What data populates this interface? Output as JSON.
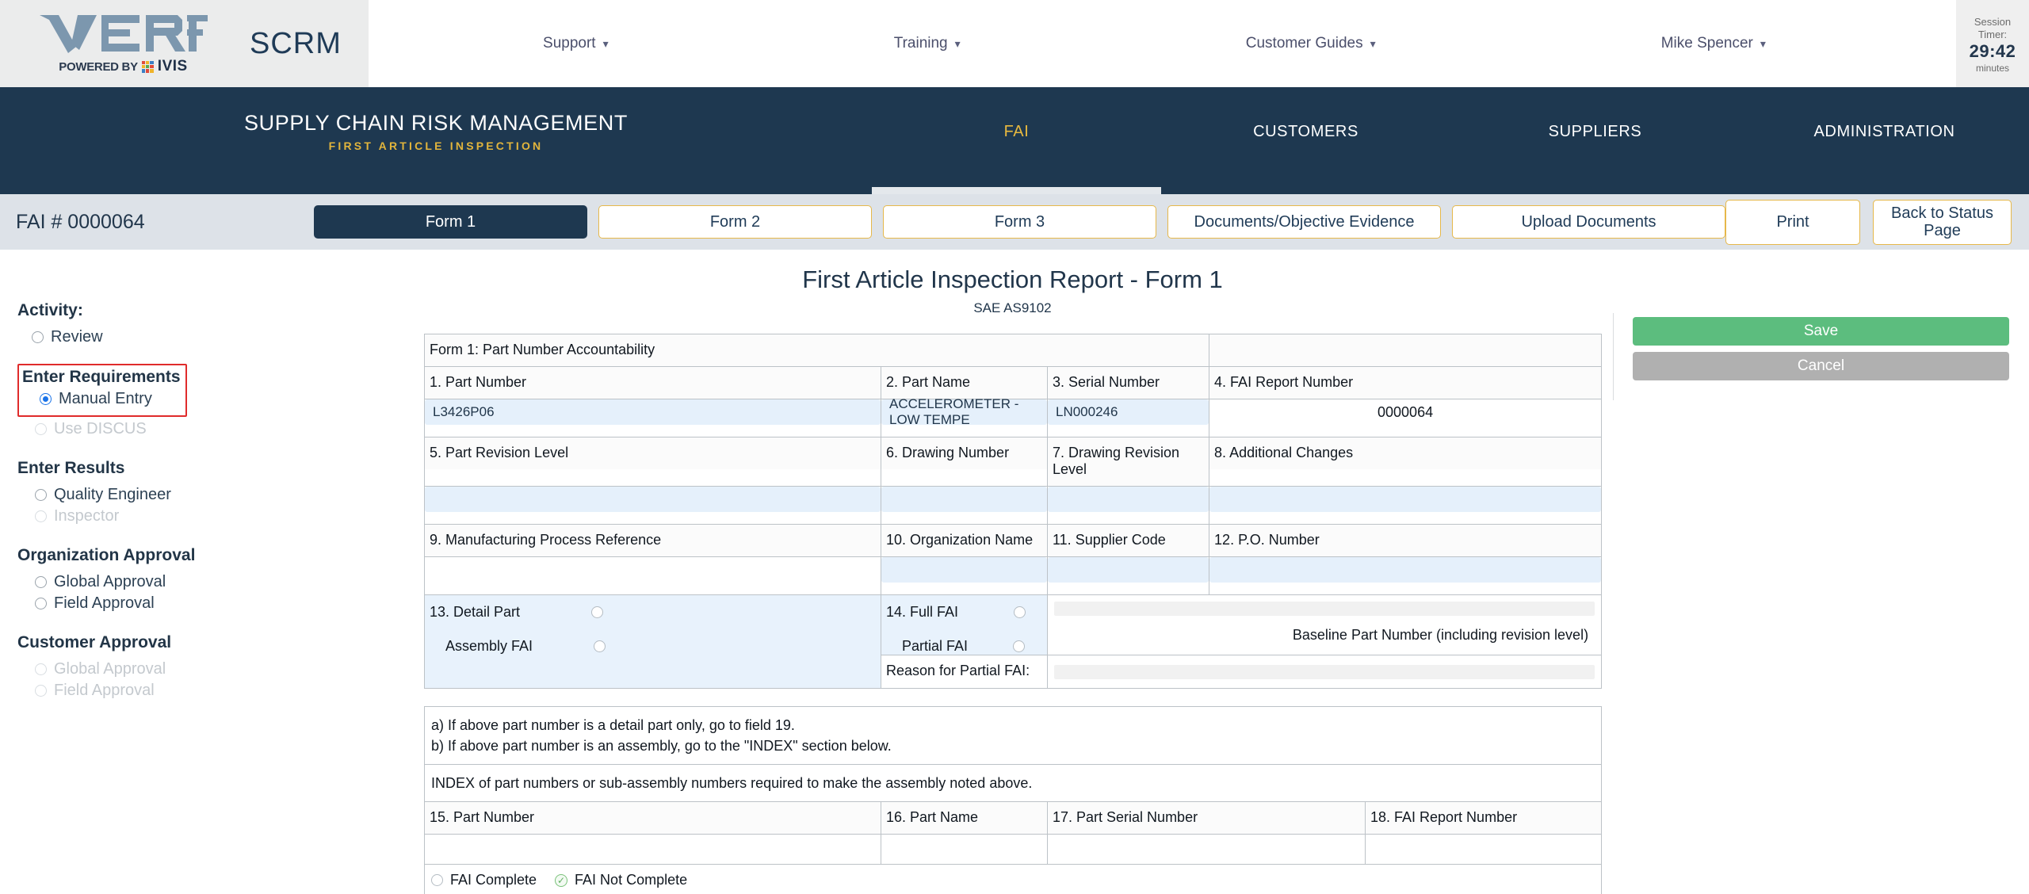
{
  "brand": {
    "logo_word": "VERIFY",
    "powered_by": "POWERED BY",
    "ivis": "IVIS",
    "product": "SCRM"
  },
  "topnav": {
    "items": [
      {
        "label": "Support",
        "icon": "chevron-down-icon"
      },
      {
        "label": "Training",
        "icon": "chevron-down-icon"
      },
      {
        "label": "Customer Guides",
        "icon": "chevron-down-icon"
      },
      {
        "label": "Mike Spencer",
        "icon": "chevron-down-icon"
      }
    ],
    "session": {
      "label_line1": "Session",
      "label_line2": "Timer:",
      "time": "29:42",
      "unit": "minutes"
    }
  },
  "darknav": {
    "title": "SUPPLY CHAIN RISK MANAGEMENT",
    "subtitle": "FIRST ARTICLE INSPECTION",
    "links": [
      {
        "label": "FAI",
        "active": true
      },
      {
        "label": "CUSTOMERS",
        "active": false
      },
      {
        "label": "SUPPLIERS",
        "active": false
      },
      {
        "label": "ADMINISTRATION",
        "active": false
      }
    ]
  },
  "subnav": {
    "fai_number": "FAI # 0000064",
    "tabs": [
      {
        "label": "Form 1",
        "active": true
      },
      {
        "label": "Form 2",
        "active": false
      },
      {
        "label": "Form 3",
        "active": false
      },
      {
        "label": "Documents/Objective Evidence",
        "active": false
      },
      {
        "label": "Upload Documents",
        "active": false
      }
    ],
    "print_label": "Print",
    "back_label": "Back to Status Page"
  },
  "sidebar": {
    "activity_label": "Activity:",
    "review": "Review",
    "enter_requirements_label": "Enter Requirements",
    "manual_entry": "Manual Entry",
    "use_discus": "Use DISCUS",
    "enter_results_label": "Enter Results",
    "quality_engineer": "Quality Engineer",
    "inspector": "Inspector",
    "organization_approval_label": "Organization Approval",
    "org_global_approval": "Global Approval",
    "org_field_approval": "Field Approval",
    "customer_approval_label": "Customer Approval",
    "cust_global_approval": "Global Approval",
    "cust_field_approval": "Field Approval",
    "highlight_color": "#e02b2b",
    "selected_radio_color": "#1a73e8"
  },
  "form": {
    "title": "First Article Inspection Report - Form 1",
    "subtitle": "SAE AS9102",
    "section_header": "Form 1: Part Number Accountability",
    "fields": {
      "h1": "1. Part Number",
      "h2": "2. Part Name",
      "h3": "3. Serial Number",
      "h4": "4. FAI Report Number",
      "v1": "L3426P06",
      "v2": "ACCELEROMETER - LOW TEMPE",
      "v3": "LN000246",
      "v4": "0000064",
      "h5": "5. Part Revision Level",
      "h6": "6. Drawing Number",
      "h7": "7. Drawing Revision Level",
      "h8": "8. Additional Changes",
      "v5": "",
      "v6": "",
      "v7": "",
      "v8": "",
      "h9": "9. Manufacturing Process Reference",
      "h10": "10. Organization Name",
      "h11": "11. Supplier Code",
      "h12": "12. P.O. Number",
      "v9": "",
      "v10": "",
      "v11": "",
      "v12": "",
      "h13": "13. Detail Part",
      "h13b": "Assembly FAI",
      "h14": "14. Full FAI",
      "h14b": "Partial FAI",
      "baseline_label": "Baseline Part Number (including revision level)",
      "reason_partial": "Reason for Partial FAI:"
    },
    "notes": {
      "a": "a) If above part number is a detail part only, go to field 19.",
      "b": "b) If above part number is an assembly, go to the \"INDEX\" section below.",
      "index": "INDEX of part numbers or sub-assembly numbers required to make the assembly noted above."
    },
    "index_table": {
      "headers": [
        "15. Part Number",
        "16. Part Name",
        "17. Part Serial Number",
        "18. FAI Report Number"
      ],
      "rows": [
        [
          "",
          "",
          "",
          ""
        ]
      ]
    },
    "completion": {
      "fai_complete": "FAI Complete",
      "fai_not_complete": "FAI Not Complete",
      "selected": "FAI Not Complete",
      "check_color": "#63ae63"
    }
  },
  "actions": {
    "save_label": "Save",
    "cancel_label": "Cancel",
    "save_color": "#5cbd7e",
    "cancel_color": "#b0b0b0"
  }
}
